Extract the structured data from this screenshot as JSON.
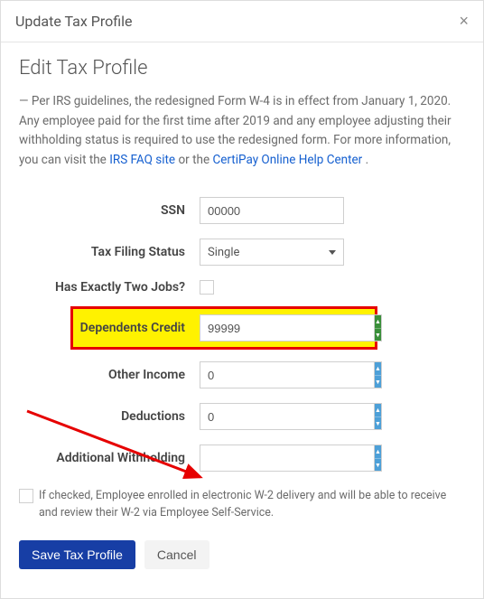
{
  "modal": {
    "title": "Update Tax Profile",
    "close_glyph": "×"
  },
  "section_title": "Edit Tax Profile",
  "info": {
    "prefix": "—  Per IRS guidelines, the redesigned Form W-4 is in effect from January 1, 2020. Any employee paid for the first time after 2019 and any employee adjusting their withholding status is required to use the redesigned form. For more information, you can visit the ",
    "link1": "IRS FAQ site",
    "middle": " or the ",
    "link2": "CertiPay Online Help Center",
    "suffix": "."
  },
  "fields": {
    "ssn": {
      "label": "SSN",
      "value": "00000"
    },
    "filing_status": {
      "label": "Tax Filing Status",
      "value": "Single"
    },
    "two_jobs": {
      "label": "Has Exactly Two Jobs?"
    },
    "dependents_credit": {
      "label": "Dependents Credit",
      "value": "99999"
    },
    "other_income": {
      "label": "Other Income",
      "value": "0"
    },
    "deductions": {
      "label": "Deductions",
      "value": "0"
    },
    "additional_withholding": {
      "label": "Additional Withholding",
      "value": ""
    }
  },
  "spinner_glyphs": {
    "up": "▲",
    "down": "▼"
  },
  "consent_text": "If checked, Employee enrolled in electronic W-2 delivery and will be able to receive and review their W-2 via Employee Self-Service.",
  "buttons": {
    "save": "Save Tax Profile",
    "cancel": "Cancel"
  }
}
